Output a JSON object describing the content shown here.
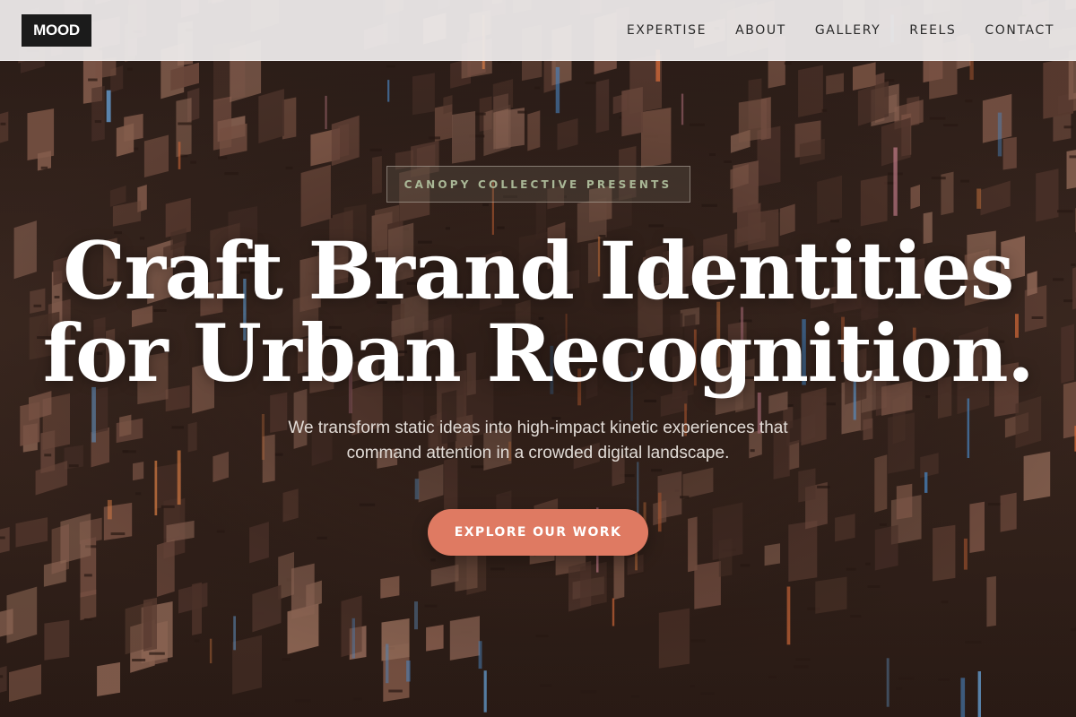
{
  "brand": {
    "logo_text": "MOOD"
  },
  "nav": {
    "items": [
      {
        "label": "EXPERTISE"
      },
      {
        "label": "ABOUT"
      },
      {
        "label": "GALLERY"
      },
      {
        "label": "REELS"
      },
      {
        "label": "CONTACT"
      }
    ]
  },
  "hero": {
    "eyebrow": "CANOPY COLLECTIVE PRESENTS",
    "headline_line1": "Craft Brand Identities",
    "headline_line2": "for Urban Recognition.",
    "subtext": "We transform static ideas into high-impact kinetic experiences that command attention in a crowded digital landscape.",
    "cta_label": "EXPLORE OUR WORK"
  },
  "colors": {
    "accent": "#df7a62",
    "eyebrow_text": "#a9b796",
    "nav_bg": "#ece9e9",
    "logo_bg": "#1b1b1b"
  }
}
